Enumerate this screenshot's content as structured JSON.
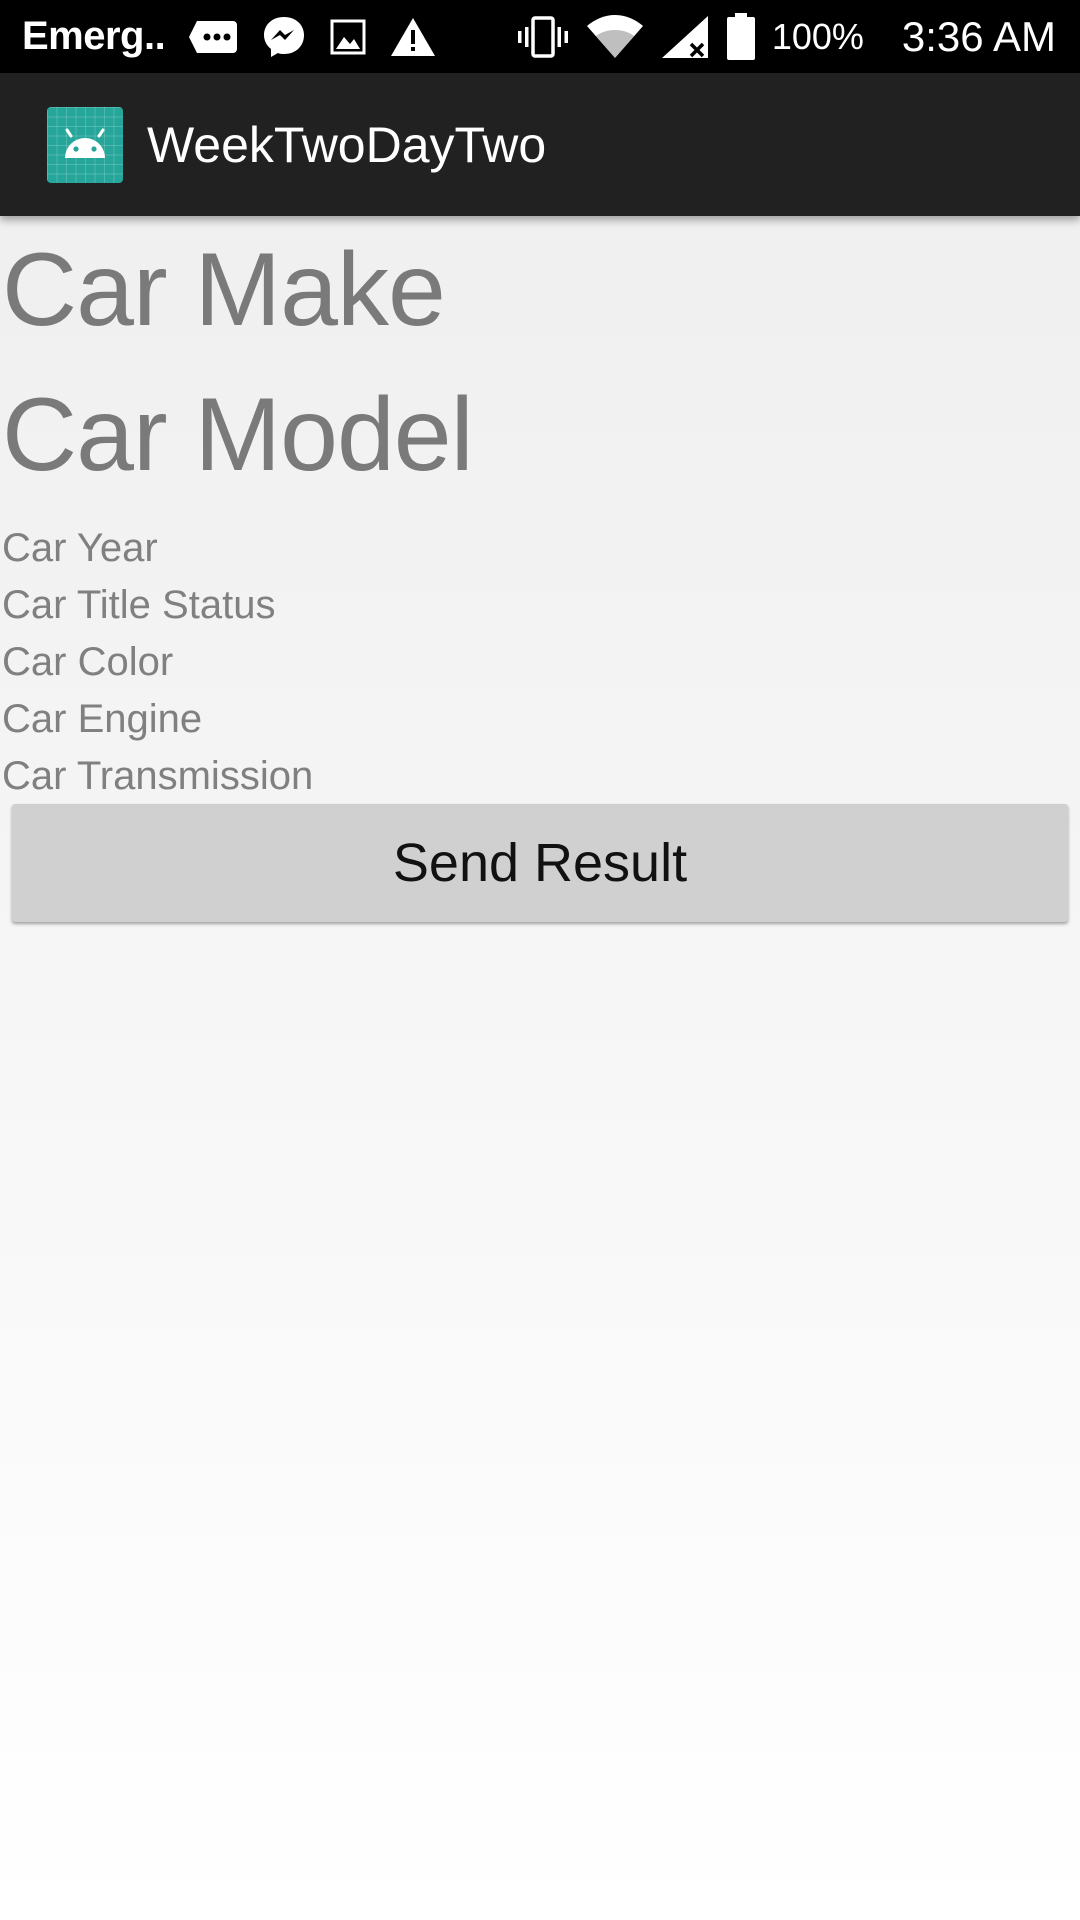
{
  "status_bar": {
    "carrier": "Emerg..",
    "icons": [
      "sms-icon",
      "messenger-icon",
      "image-icon",
      "warning-icon",
      "vibrate-icon",
      "wifi-icon",
      "signal-icon",
      "battery-icon"
    ],
    "battery_percent": "100%",
    "time": "3:36 AM"
  },
  "action_bar": {
    "app_icon": "android-icon",
    "title": "WeekTwoDayTwo"
  },
  "main": {
    "car_make": "Car Make",
    "car_model": "Car Model",
    "car_year": "Car Year",
    "car_title_status": "Car Title Status",
    "car_color": "Car Color",
    "car_engine": "Car Engine",
    "car_transmission": "Car Transmission",
    "send_button_label": "Send Result"
  },
  "colors": {
    "status_bar_bg": "#000000",
    "action_bar_bg": "#212121",
    "app_icon_bg": "#26a69a",
    "text_gray": "#7a7a7a",
    "button_bg": "#d0d0d0"
  }
}
